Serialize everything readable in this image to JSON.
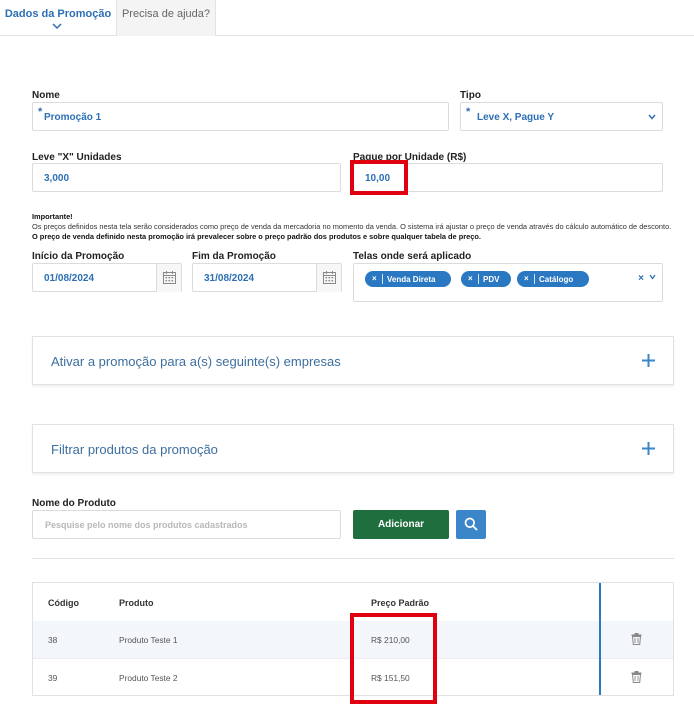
{
  "tabs": {
    "active": "Dados da Promoção",
    "help": "Precisa de ajuda?"
  },
  "form": {
    "nome_label": "Nome",
    "nome_value": "Promoção 1",
    "tipo_label": "Tipo",
    "tipo_value": "Leve X, Pague Y",
    "leve_label": "Leve \"X\" Unidades",
    "leve_value": "3,000",
    "pague_label": "Pague por Unidade (R$)",
    "pague_value": "10,00",
    "required_mark": "*"
  },
  "note": {
    "title": "Importante!",
    "text": "Os preços definidos nesta tela serão considerados como preço de venda da mercadoria no momento da venda. O sistema irá ajustar o preço de venda através do cálculo automático de desconto. ",
    "bold": "O preço de venda definido nesta promoção irá prevalecer sobre o preço padrão dos produtos e sobre qualquer tabela de preço."
  },
  "dates": {
    "inicio_label": "Início da Promoção",
    "inicio_value": "01/08/2024",
    "fim_label": "Fim da Promoção",
    "fim_value": "31/08/2024"
  },
  "telas": {
    "label": "Telas onde será aplicado",
    "chip_remove": "×",
    "chips": [
      "Venda Direta",
      "PDV",
      "Catálogo"
    ],
    "clear": "×"
  },
  "accordions": [
    "Ativar a promoção para a(s) seguinte(s) empresas",
    "Filtrar produtos da promoção"
  ],
  "product_search": {
    "label": "Nome do Produto",
    "placeholder": "Pesquise pelo nome dos produtos cadastrados",
    "add_button": "Adicionar"
  },
  "table": {
    "headers": [
      "Código",
      "Produto",
      "Preço Padrão"
    ],
    "rows": [
      {
        "codigo": "38",
        "produto": "Produto Teste 1",
        "preco": "R$ 210,00"
      },
      {
        "codigo": "39",
        "produto": "Produto Teste 2",
        "preco": "R$ 151,50"
      }
    ]
  },
  "colors": {
    "accent": "#2c6fb5",
    "chip": "#2b78c2",
    "add_button": "#1e6e3e",
    "highlight": "#e0000f"
  }
}
